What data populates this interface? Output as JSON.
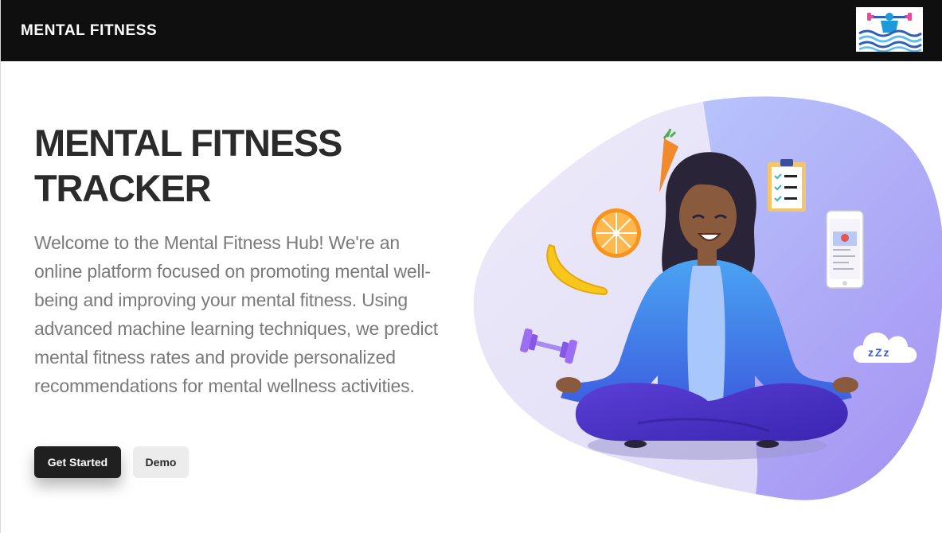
{
  "header": {
    "brand": "MENTAL FITNESS",
    "logo_icon": "swimmer-weights-logo-icon"
  },
  "hero": {
    "title": "MENTAL FITNESS TRACKER",
    "description": "Welcome to the Mental Fitness Hub! We're an online platform focused on promoting mental well-being and improving your mental fitness. Using advanced machine learning techniques, we predict mental fitness rates and provide personalized recommendations for mental wellness activities.",
    "primary_button": "Get Started",
    "secondary_button": "Demo"
  },
  "illustration": {
    "sleep_text": "zZz",
    "icons": [
      "carrot-icon",
      "orange-slice-icon",
      "banana-icon",
      "dumbbell-icon",
      "clipboard-checklist-icon",
      "smartphone-icon",
      "sleep-cloud-icon",
      "meditating-woman-illustration"
    ]
  },
  "colors": {
    "nav_background": "#0f0f0f",
    "title_text": "#2b2b2b",
    "body_text": "#7a7a7a",
    "primary_button": "#202020",
    "secondary_button": "#ececec",
    "blob_light": "#ece9f8",
    "blob_accent": "#a9a6f5"
  }
}
